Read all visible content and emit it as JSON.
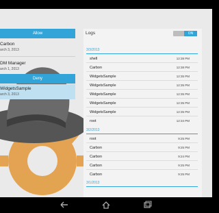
{
  "left_pane": {
    "allow_label": "Allow",
    "deny_label": "Deny",
    "allowed_apps": [
      {
        "name": "Carbon",
        "date": "arch 3, 2013"
      },
      {
        "name": "DM Manager",
        "date": "arch 1, 2013"
      }
    ],
    "denied_apps": [
      {
        "name": "WidgetsSample",
        "date": "arch 3, 2013"
      }
    ]
  },
  "logs": {
    "title": "Logs",
    "toggle_label": "ON",
    "groups": [
      {
        "date": "3/3/2013",
        "entries": [
          {
            "name": "shell",
            "time": "12:38 PM"
          },
          {
            "name": "Carbon",
            "time": "12:38 PM"
          },
          {
            "name": "WidgetsSample",
            "time": "12:35 PM"
          },
          {
            "name": "WidgetsSample",
            "time": "12:35 PM"
          },
          {
            "name": "WidgetsSample",
            "time": "12:35 PM"
          },
          {
            "name": "WidgetsSample",
            "time": "12:35 PM"
          },
          {
            "name": "WidgetsSample",
            "time": "12:35 PM"
          },
          {
            "name": "root",
            "time": "12:34 PM"
          }
        ]
      },
      {
        "date": "3/2/2013",
        "entries": [
          {
            "name": "root",
            "time": "9:25 PM"
          },
          {
            "name": "Carbon",
            "time": "9:25 PM"
          },
          {
            "name": "Carbon",
            "time": "9:24 PM"
          },
          {
            "name": "Carbon",
            "time": "9:25 PM"
          },
          {
            "name": "Carbon",
            "time": "9:25 PM"
          }
        ]
      },
      {
        "date": "3/1/2013",
        "entries": []
      }
    ]
  },
  "colors": {
    "accent": "#33a4d8",
    "background": "#eaeaea"
  },
  "navbar": {
    "icons": [
      "back-icon",
      "home-icon",
      "recent-apps-icon"
    ]
  }
}
